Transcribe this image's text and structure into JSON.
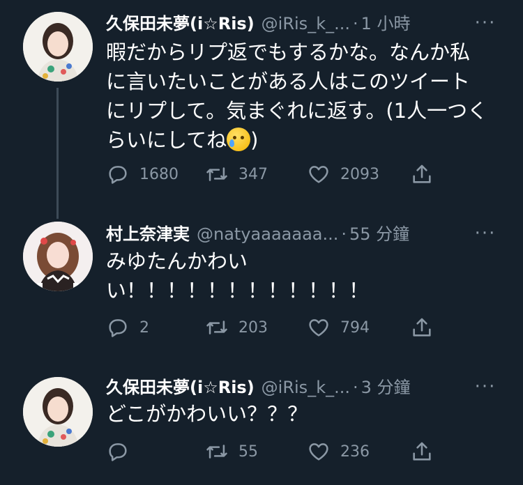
{
  "tweets": [
    {
      "name": "久保田未夢(i☆Ris)",
      "handle": "@iRis_k_...",
      "dot": "·",
      "time": "1 小時",
      "text_lines": [
        "暇だからリプ返でもするかな。なんか私",
        "に言いたいことがある人はこのツイート",
        "にリプして。気まぐれに返す。(1人一つく",
        "らいにしてね"
      ],
      "text_end": ")",
      "emoji": "face-holding-back-tears",
      "replies": "1680",
      "retweets": "347",
      "likes": "2093"
    },
    {
      "name": "村上奈津実",
      "handle": "@natyaaaaaaa...",
      "dot": "·",
      "time": "55 分鐘",
      "text_lines": [
        "みゆたんかわい",
        "い！！！！！！！！！！！！"
      ],
      "replies": "2",
      "retweets": "203",
      "likes": "794"
    },
    {
      "name": "久保田未夢(i☆Ris)",
      "handle": "@iRis_k_...",
      "dot": "·",
      "time": "3 分鐘",
      "text_lines": [
        "どこがかわいい？？？"
      ],
      "replies": "",
      "retweets": "55",
      "likes": "236"
    }
  ],
  "more_label": "···",
  "colors": {
    "background": "#15202b",
    "text": "#ffffff",
    "secondary": "#8b98a5",
    "thread_line": "#3d4b58"
  }
}
